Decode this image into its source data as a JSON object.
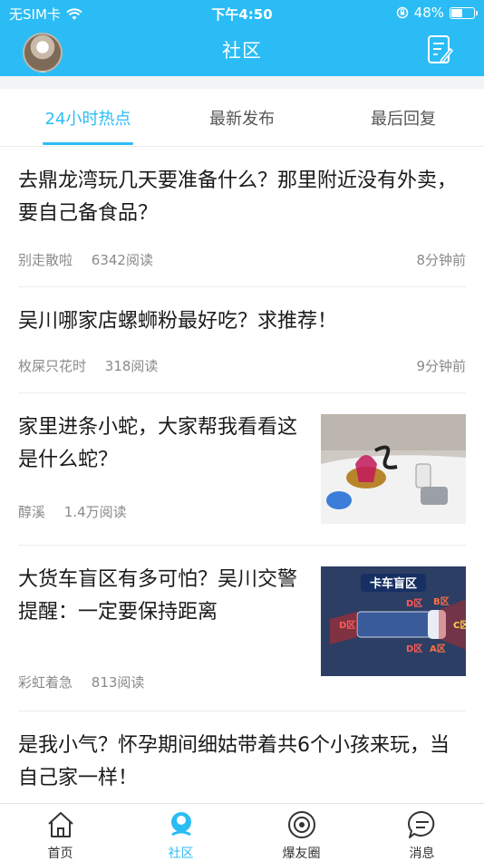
{
  "status_bar": {
    "carrier": "无SIM卡",
    "time": "下午4:50",
    "battery": "48%",
    "battery_level": 0.48
  },
  "nav": {
    "title": "社区",
    "avatar_icon": "avatar",
    "compose_icon": "compose-icon"
  },
  "tabs": [
    {
      "label": "24小时热点",
      "active": true
    },
    {
      "label": "最新发布",
      "active": false
    },
    {
      "label": "最后回复",
      "active": false
    }
  ],
  "posts": [
    {
      "title": "去鼎龙湾玩几天要准备什么？那里附近没有外卖，要自己备食品？",
      "author": "别走散啦",
      "reads": "6342阅读",
      "time": "8分钟前"
    },
    {
      "title": "吴川哪家店螺蛳粉最好吃？求推荐！",
      "author": "枚屎只花时",
      "reads": "318阅读",
      "time": "9分钟前"
    },
    {
      "title": "家里进条小蛇，大家帮我看看这是什么蛇？",
      "author": "醇溪",
      "reads": "1.4万阅读",
      "time": ""
    },
    {
      "title": "大货车盲区有多可怕？吴川交警提醒：一定要保持距离",
      "author": "彩虹着急",
      "reads": "813阅读",
      "time": "",
      "thumb_title": "卡车盲区",
      "thumb_labels": [
        "D区",
        "B区",
        "D区",
        "C区",
        "D区",
        "A区"
      ]
    },
    {
      "title": "是我小气？怀孕期间细姑带着共6个小孩来玩，当自己家一样！",
      "author": "",
      "reads": "",
      "time": ""
    }
  ],
  "tabbar": [
    {
      "label": "首页",
      "icon": "home-icon",
      "active": false
    },
    {
      "label": "社区",
      "icon": "community-icon",
      "active": true
    },
    {
      "label": "爆友圈",
      "icon": "circle-icon",
      "active": false
    },
    {
      "label": "消息",
      "icon": "message-icon",
      "active": false
    }
  ],
  "colors": {
    "accent": "#2bbcf5",
    "meta": "#8a8a8a"
  }
}
